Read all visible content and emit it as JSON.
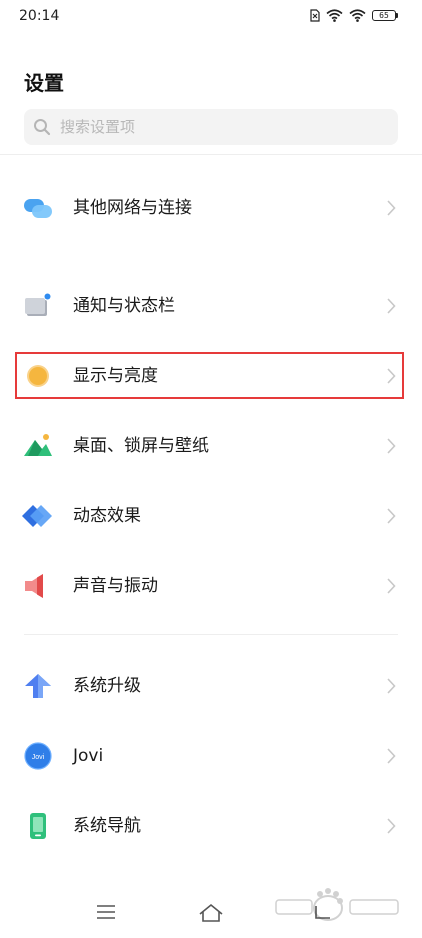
{
  "status_bar": {
    "time": "20:14",
    "battery_level": "65"
  },
  "page": {
    "title": "设置"
  },
  "search": {
    "placeholder": "搜索设置项"
  },
  "items": [
    {
      "label": "其他网络与连接",
      "icon": "network-connection-icon"
    },
    {
      "label": "通知与状态栏",
      "icon": "notification-icon"
    },
    {
      "label": "显示与亮度",
      "icon": "display-brightness-icon"
    },
    {
      "label": "桌面、锁屏与壁纸",
      "icon": "wallpaper-icon"
    },
    {
      "label": "动态效果",
      "icon": "motion-effects-icon"
    },
    {
      "label": "声音与振动",
      "icon": "sound-vibration-icon"
    },
    {
      "label": "系统升级",
      "icon": "system-update-icon"
    },
    {
      "label": "Jovi",
      "icon": "jovi-icon",
      "icon_text": "Jovi"
    },
    {
      "label": "系统导航",
      "icon": "system-navigation-icon"
    }
  ],
  "highlight": {
    "target": "显示与亮度",
    "color": "#e63a3a"
  },
  "colors": {
    "background": "#ffffff",
    "search_bg": "#f3f3f3",
    "chevron": "#c8c8c8"
  }
}
